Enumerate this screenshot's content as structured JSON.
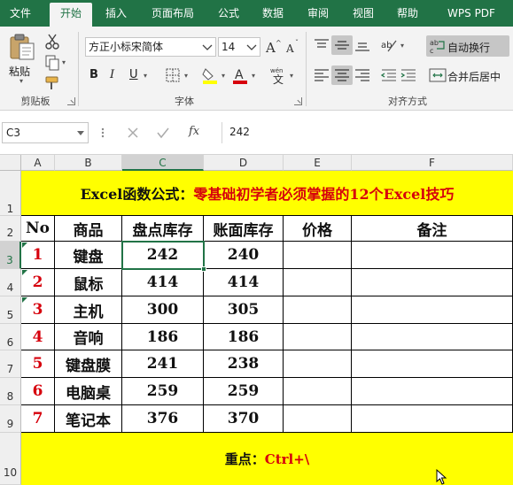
{
  "ribbon": {
    "tabs": [
      "文件",
      "开始",
      "插入",
      "页面布局",
      "公式",
      "数据",
      "审阅",
      "视图",
      "帮助",
      "WPS PDF"
    ],
    "active_tab": "开始",
    "clipboard": {
      "paste_label": "粘贴",
      "group_label": "剪贴板"
    },
    "font": {
      "family": "方正小标宋简体",
      "size": "14",
      "group_label": "字体",
      "bold": "B",
      "italic": "I",
      "underline": "U"
    },
    "alignment": {
      "group_label": "对齐方式",
      "wrap_text": "自动换行",
      "merge_center": "合并后居中"
    }
  },
  "formula_bar": {
    "name_box": "C3",
    "fx_label": "fx",
    "value": "242"
  },
  "sheet": {
    "columns": [
      "A",
      "B",
      "C",
      "D",
      "E",
      "F"
    ],
    "rows": [
      "1",
      "2",
      "3",
      "4",
      "5",
      "6",
      "7",
      "8",
      "9",
      "10"
    ],
    "selected_column": "C",
    "selected_row": "3",
    "title_black": "Excel函数公式：",
    "title_red": "零基础初学者必须掌握的12个Excel技巧",
    "headers": [
      "No",
      "商品",
      "盘点库存",
      "账面库存",
      "价格",
      "备注"
    ],
    "data": [
      {
        "no": "1",
        "item": "键盘",
        "count": "242",
        "book": "240"
      },
      {
        "no": "2",
        "item": "鼠标",
        "count": "414",
        "book": "414"
      },
      {
        "no": "3",
        "item": "主机",
        "count": "300",
        "book": "305"
      },
      {
        "no": "4",
        "item": "音响",
        "count": "186",
        "book": "186"
      },
      {
        "no": "5",
        "item": "键盘膜",
        "count": "241",
        "book": "238"
      },
      {
        "no": "6",
        "item": "电脑桌",
        "count": "259",
        "book": "259"
      },
      {
        "no": "7",
        "item": "笔记本",
        "count": "376",
        "book": "370"
      }
    ],
    "footer_black": "重点：",
    "footer_red": "Ctrl+\\"
  },
  "colors": {
    "excel_green": "#217346",
    "highlight_yellow": "#ffff00",
    "accent_red": "#d6000c"
  }
}
